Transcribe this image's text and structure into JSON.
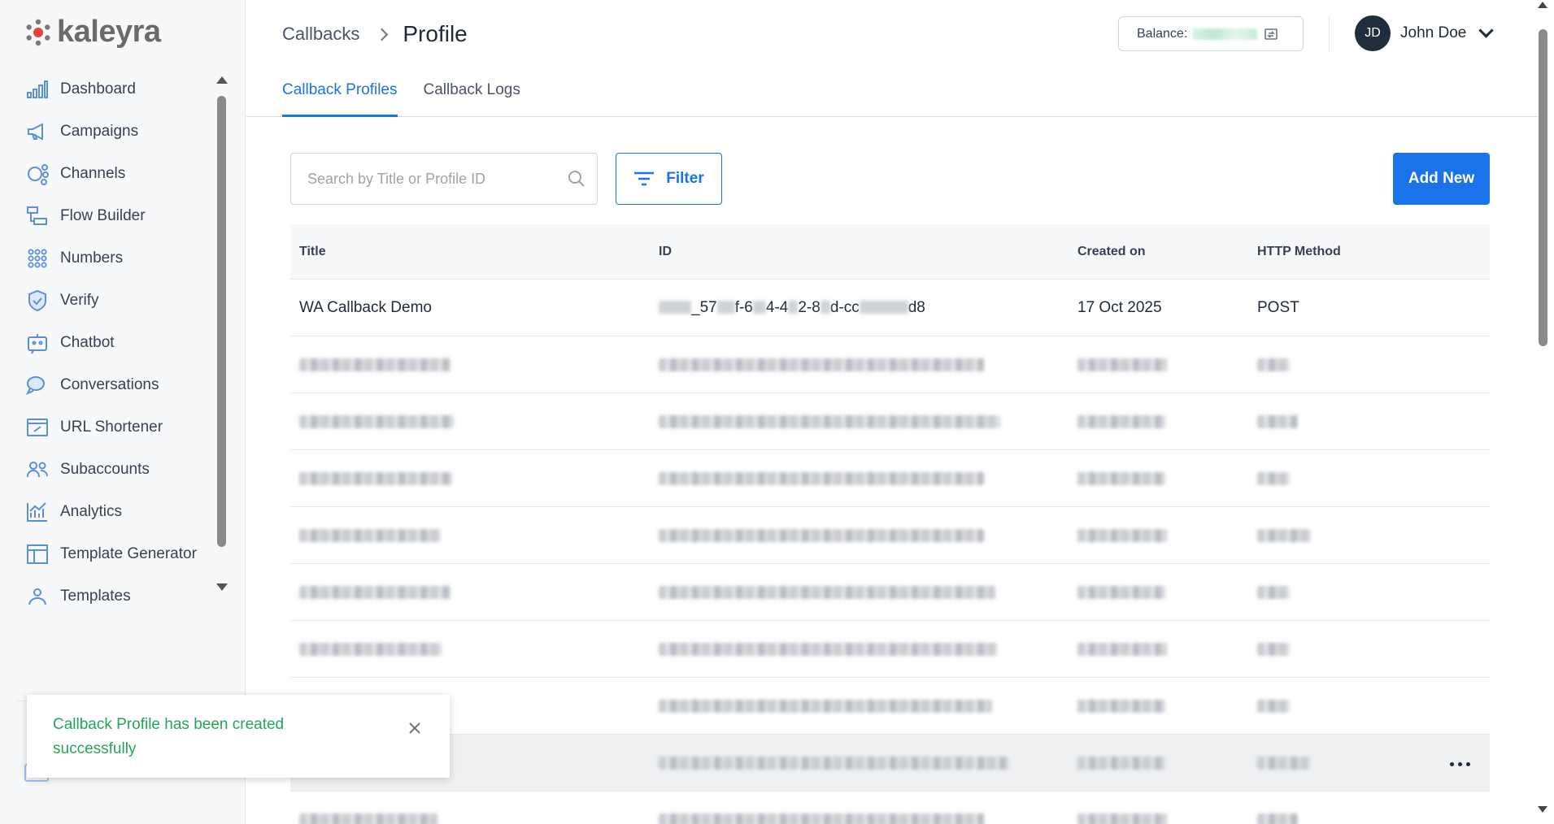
{
  "app": {
    "brand": "kaleyra",
    "brand_color": "#6b6b6b",
    "accent": "#1a73e8",
    "success": "#22a55b"
  },
  "sidebar": {
    "items": [
      {
        "label": "Dashboard",
        "icon": "dashboard-icon"
      },
      {
        "label": "Campaigns",
        "icon": "megaphone-icon"
      },
      {
        "label": "Channels",
        "icon": "channels-icon"
      },
      {
        "label": "Flow Builder",
        "icon": "flow-builder-icon"
      },
      {
        "label": "Numbers",
        "icon": "numbers-grid-icon"
      },
      {
        "label": "Verify",
        "icon": "shield-check-icon"
      },
      {
        "label": "Chatbot",
        "icon": "chatbot-icon"
      },
      {
        "label": "Conversations",
        "icon": "chat-bubbles-icon"
      },
      {
        "label": "URL Shortener",
        "icon": "link-icon"
      },
      {
        "label": "Subaccounts",
        "icon": "users-icon"
      },
      {
        "label": "Analytics",
        "icon": "analytics-icon"
      },
      {
        "label": "Template Generator",
        "icon": "layout-icon"
      },
      {
        "label": "Templates",
        "icon": "templates-icon"
      }
    ]
  },
  "header": {
    "breadcrumb": {
      "parent": "Callbacks",
      "current": "Profile"
    },
    "balance_label": "Balance:",
    "user": {
      "initials": "JD",
      "name": "John Doe"
    },
    "tabs": [
      {
        "label": "Callback Profiles",
        "active": true
      },
      {
        "label": "Callback Logs",
        "active": false
      }
    ]
  },
  "toolbar": {
    "search_placeholder": "Search by Title or Profile ID",
    "filter_label": "Filter",
    "add_label": "Add New"
  },
  "table": {
    "columns": [
      "Title",
      "ID",
      "Created on",
      "HTTP Method"
    ],
    "rows": [
      {
        "title": "WA Callback Demo",
        "id_prefix": "_57",
        "id_parts": [
          "f-6",
          "4-4",
          "2-8",
          "d-cc",
          "d8"
        ],
        "created": "17 Oct 2025",
        "method": "POST"
      }
    ]
  },
  "toast": {
    "message": "Callback Profile has been created successfully"
  }
}
